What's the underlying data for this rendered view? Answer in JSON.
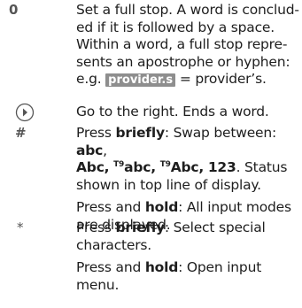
{
  "rows": {
    "zero": {
      "key": "0",
      "text_1": "Set a full stop. A word is conclud-",
      "text_2": "ed if it is followed by a space.",
      "text_3": "Within a word, a full stop repre-",
      "text_4": "sents an apostrophe or hyphen:",
      "example_prefix": "e.g.",
      "example_highlight": "provider.s",
      "example_suffix": "= provider’s."
    },
    "nav": {
      "icon": "navigation-key-right-icon",
      "text": "Go to the right. Ends a word."
    },
    "hash": {
      "key": "#",
      "p1_a": "Press",
      "p1_bold": "briefly",
      "p1_b": ": Swap between:",
      "mode_abc": "abc",
      "mode_Abc": "Abc,",
      "t9": "T9",
      "mode_t9abc": "abc,",
      "mode_t9Abc": "Abc,",
      "mode_123": "123",
      "p1_c": ". Status",
      "p1_d": "shown in top line of display.",
      "p2_a": "Press and",
      "p2_bold": "hold",
      "p2_b": ": All input modes",
      "p2_c": "are displayed."
    },
    "star": {
      "key": "*",
      "p1_a": "Press",
      "p1_bold": "briefly",
      "p1_b": ": Select special",
      "p1_c": "characters.",
      "p2_a": "Press and",
      "p2_bold": "hold",
      "p2_b": ": Open input",
      "p2_c": "menu."
    }
  },
  "colors": {
    "highlight_bg": "#8e8e8e",
    "key_text": "#555555",
    "body_text": "#1e1e1e"
  }
}
